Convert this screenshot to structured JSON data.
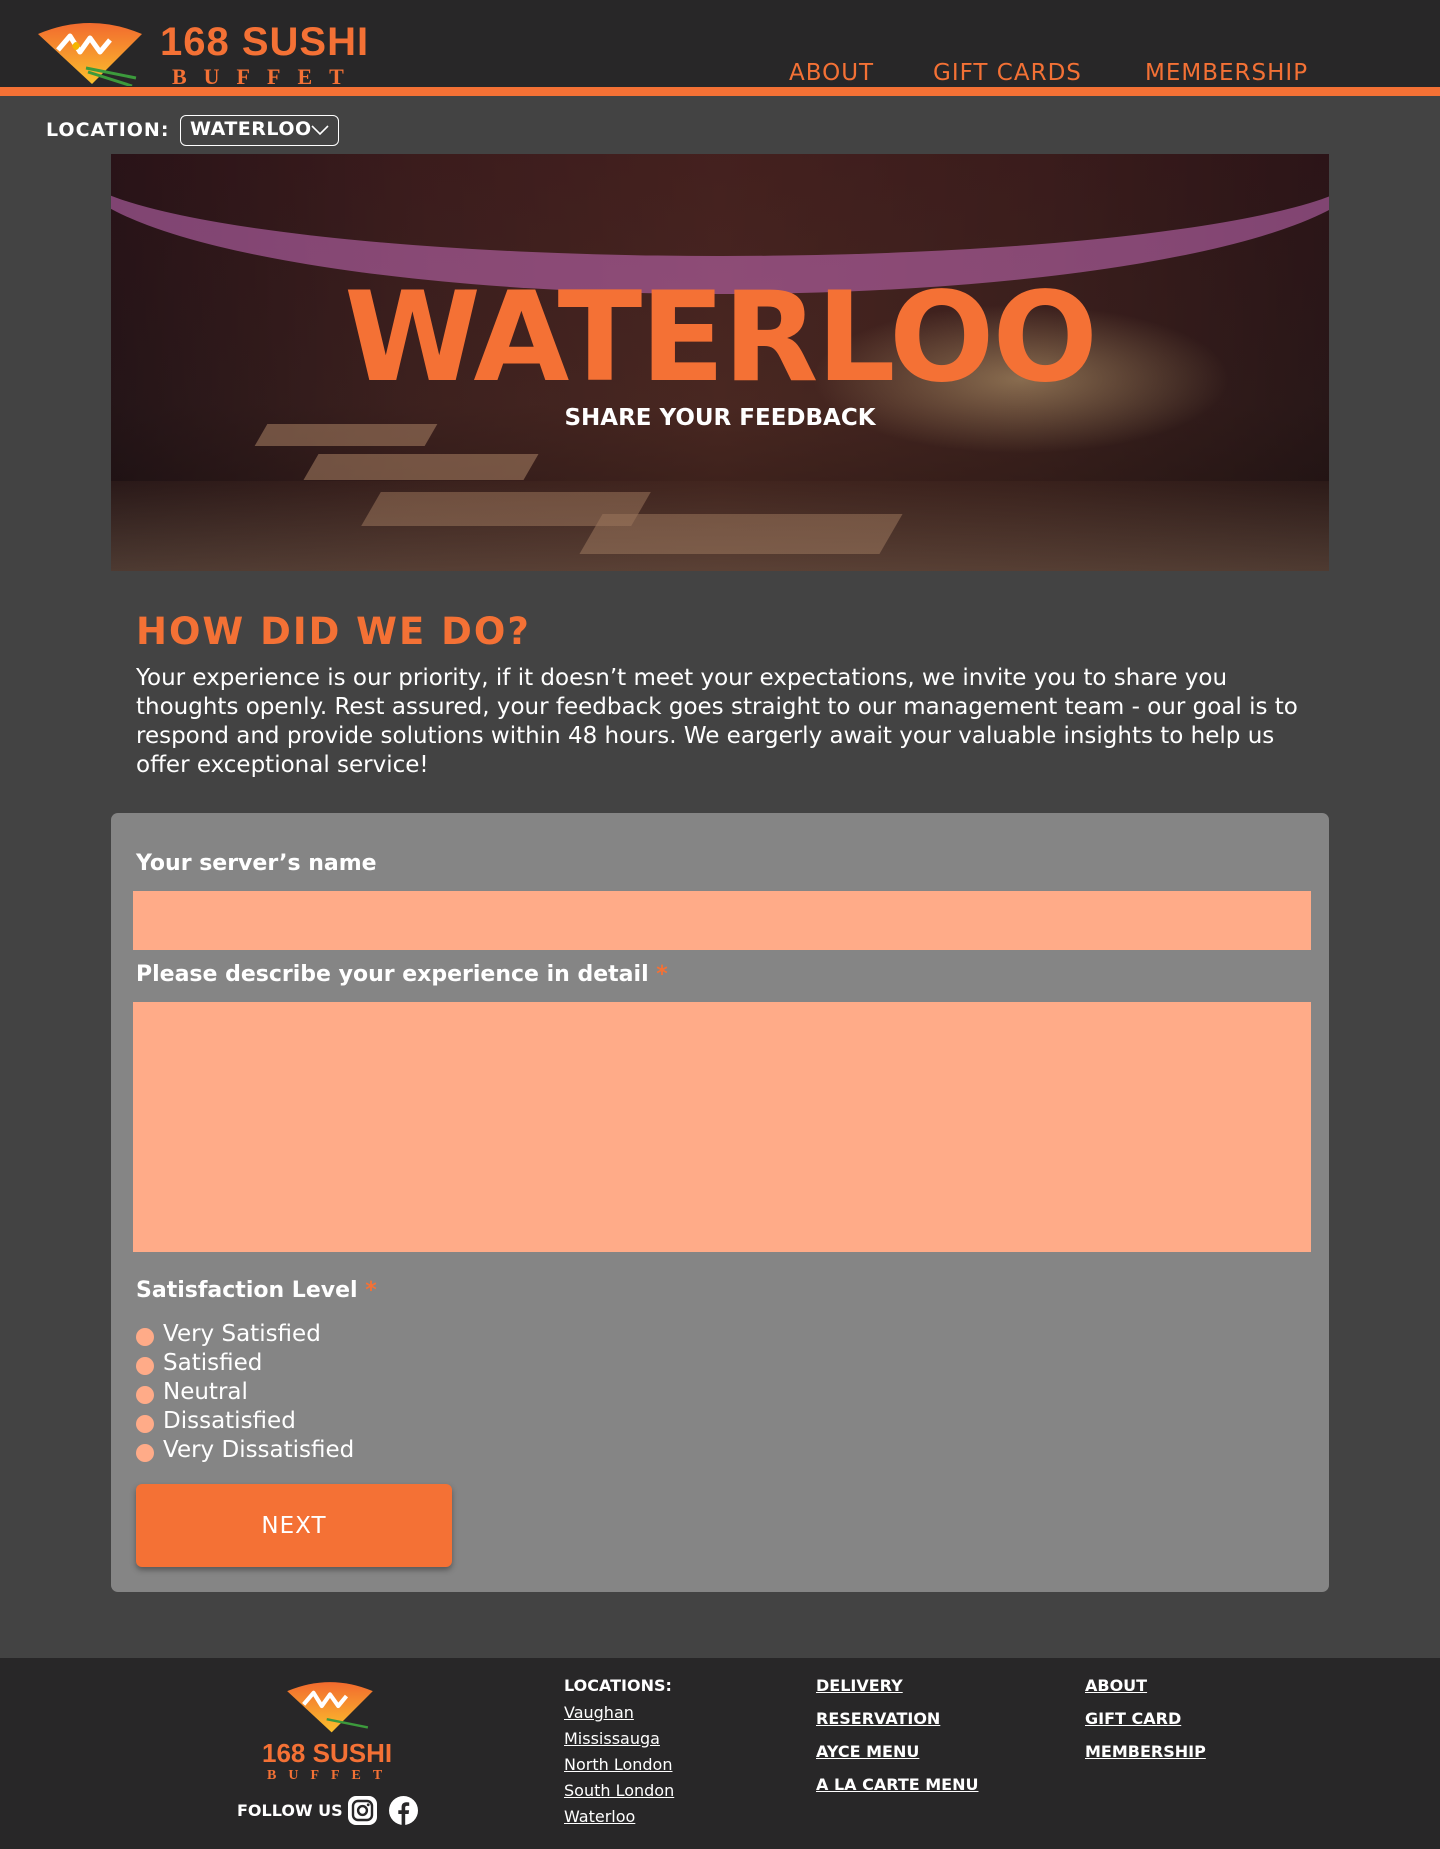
{
  "header": {
    "brand_line1": "168 SUSHI",
    "brand_line2": "BUFFET",
    "nav": [
      "ABOUT",
      "GIFT CARDS",
      "MEMBERSHIP"
    ]
  },
  "location": {
    "label": "LOCATION:",
    "selected": "WATERLOO"
  },
  "hero": {
    "title": "WATERLOO",
    "subtitle": "SHARE YOUR FEEDBACK"
  },
  "intro": {
    "title": "HOW DID WE DO?",
    "text": "Your experience is our priority, if it doesn’t meet your expectations, we invite you to share you thoughts openly. Rest assured, your feedback goes straight to our management team - our goal is to respond and provide solutions within 48 hours. We eargerly await your valuable insights to help us offer exceptional service!"
  },
  "form": {
    "server_label": "Your server’s name",
    "server_value": "",
    "experience_label": "Please describe your experience in detail",
    "experience_value": "",
    "required_mark": "*",
    "satisfaction_label": "Satisfaction Level",
    "satisfaction_options": [
      "Very Satisfied",
      "Satisfied",
      "Neutral",
      "Dissatisfied",
      "Very Dissatisfied"
    ],
    "next_label": "NEXT"
  },
  "footer": {
    "brand_line1": "168 SUSHI",
    "brand_line2": "BUFFET",
    "follow_label": "FOLLOW US",
    "locations_title": "LOCATIONS:",
    "locations": [
      "Vaughan",
      "Mississauga",
      "North London",
      "South London",
      "Waterloo"
    ],
    "links_col2": [
      "DELIVERY",
      "RESERVATION",
      "AYCE MENU",
      "A LA CARTE MENU"
    ],
    "links_col3": [
      "ABOUT",
      "GIFT CARD",
      "MEMBERSHIP"
    ]
  },
  "colors": {
    "accent": "#f47135",
    "input_bg": "#ffab88",
    "page_bg": "#434343",
    "header_bg": "#282728",
    "card_bg": "#858585"
  },
  "icons": [
    "fan-logo-icon",
    "chevron-down-icon",
    "instagram-icon",
    "facebook-icon"
  ]
}
